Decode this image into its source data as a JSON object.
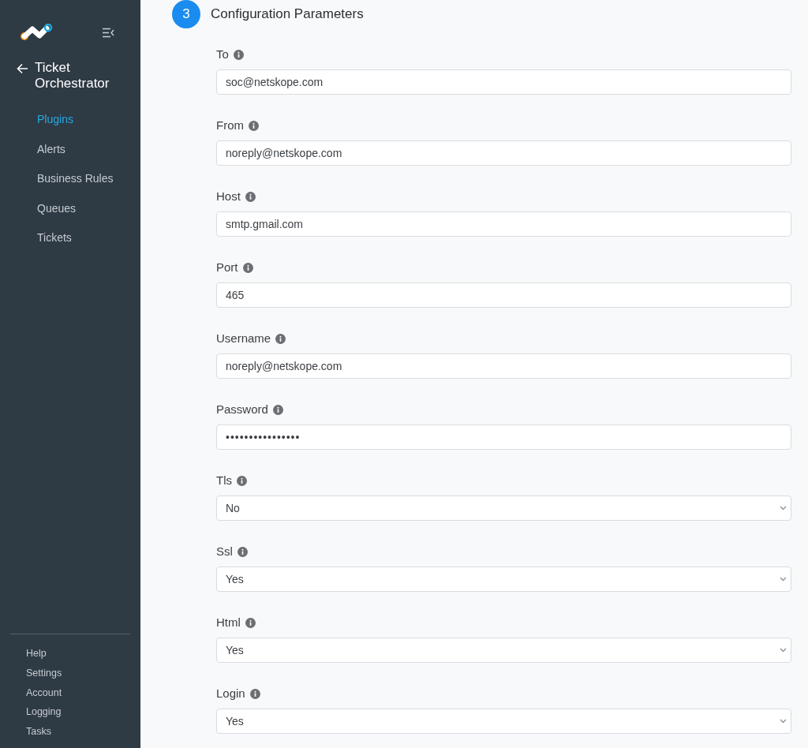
{
  "sidebar": {
    "back_title": [
      "Ticket",
      "Orchestrator"
    ],
    "nav": [
      {
        "label": "Plugins",
        "selected": true
      },
      {
        "label": "Alerts",
        "selected": false
      },
      {
        "label": "Business Rules",
        "selected": false
      },
      {
        "label": "Queues",
        "selected": false
      },
      {
        "label": "Tickets",
        "selected": false
      }
    ],
    "footer": [
      "Help",
      "Settings",
      "Account",
      "Logging",
      "Tasks"
    ]
  },
  "section": {
    "step": "3",
    "title": "Configuration Parameters"
  },
  "fields": [
    {
      "label": "To",
      "kind": "text",
      "value": "soc@netskope.com"
    },
    {
      "label": "From",
      "kind": "text",
      "value": "noreply@netskope.com"
    },
    {
      "label": "Host",
      "kind": "text",
      "value": "smtp.gmail.com"
    },
    {
      "label": "Port",
      "kind": "text",
      "value": "465"
    },
    {
      "label": "Username",
      "kind": "text",
      "value": "noreply@netskope.com"
    },
    {
      "label": "Password",
      "kind": "password",
      "value": "••••••••••••••••"
    },
    {
      "label": "Tls",
      "kind": "select",
      "value": "No"
    },
    {
      "label": "Ssl",
      "kind": "select",
      "value": "Yes"
    },
    {
      "label": "Html",
      "kind": "select",
      "value": "Yes"
    },
    {
      "label": "Login",
      "kind": "select",
      "value": "Yes"
    }
  ]
}
